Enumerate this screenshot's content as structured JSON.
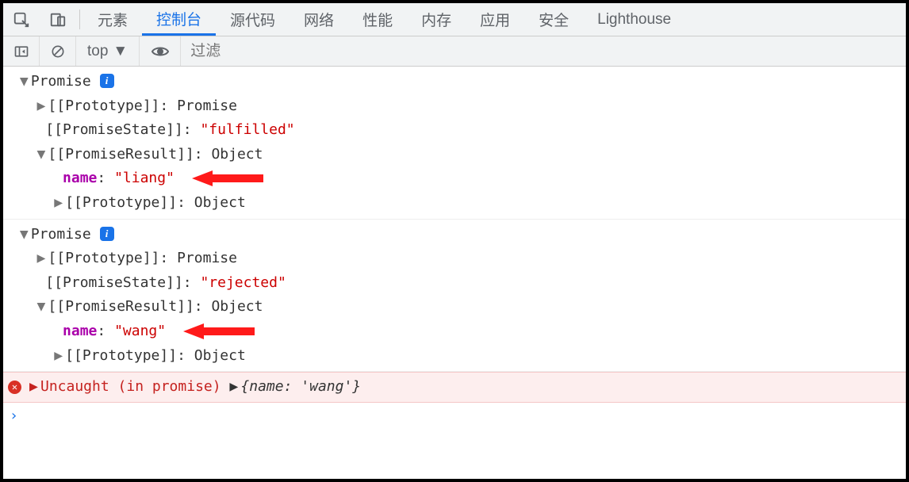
{
  "tabs": {
    "elements": "元素",
    "console": "控制台",
    "sources": "源代码",
    "network": "网络",
    "performance": "性能",
    "memory": "内存",
    "application": "应用",
    "security": "安全",
    "lighthouse": "Lighthouse"
  },
  "toolbar": {
    "context_label": "top",
    "filter_placeholder": "过滤"
  },
  "entries": [
    {
      "header": "Promise",
      "prototype": {
        "label": "[[Prototype]]",
        "value": "Promise"
      },
      "state": {
        "label": "[[PromiseState]]",
        "value": "\"fulfilled\""
      },
      "result": {
        "label": "[[PromiseResult]]",
        "value": "Object",
        "name_key": "name",
        "name_value": "\"liang\"",
        "proto_label": "[[Prototype]]",
        "proto_value": "Object"
      }
    },
    {
      "header": "Promise",
      "prototype": {
        "label": "[[Prototype]]",
        "value": "Promise"
      },
      "state": {
        "label": "[[PromiseState]]",
        "value": "\"rejected\""
      },
      "result": {
        "label": "[[PromiseResult]]",
        "value": "Object",
        "name_key": "name",
        "name_value": "\"wang\"",
        "proto_label": "[[Prototype]]",
        "proto_value": "Object"
      }
    }
  ],
  "error": {
    "message": "Uncaught (in promise)",
    "preview": "{name: 'wang'}"
  },
  "prompt": "›"
}
